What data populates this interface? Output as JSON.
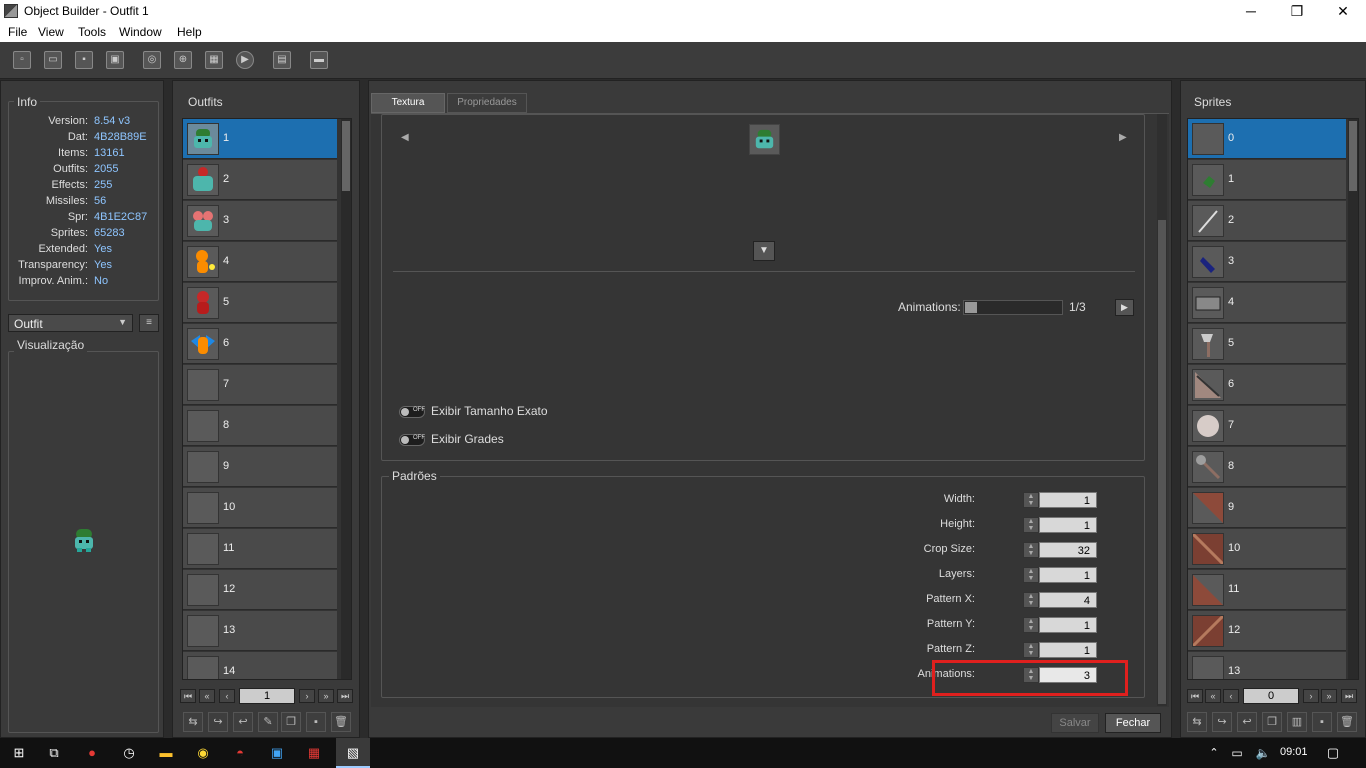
{
  "window": {
    "title": "Object Builder - Outfit 1",
    "minimize": "─",
    "maximize": "❐",
    "close": "✕"
  },
  "menu": [
    "File",
    "View",
    "Tools",
    "Window",
    "Help"
  ],
  "info": {
    "title": "Info",
    "rows": [
      {
        "k": "Version:",
        "v": "8.54 v3"
      },
      {
        "k": "Dat:",
        "v": "4B28B89E"
      },
      {
        "k": "Items:",
        "v": "13161"
      },
      {
        "k": "Outfits:",
        "v": "2055"
      },
      {
        "k": "Effects:",
        "v": "255"
      },
      {
        "k": "Missiles:",
        "v": "56"
      },
      {
        "k": "Spr:",
        "v": "4B1E2C87"
      },
      {
        "k": "Sprites:",
        "v": "65283"
      },
      {
        "k": "Extended:",
        "v": "Yes"
      },
      {
        "k": "Transparency:",
        "v": "Yes"
      },
      {
        "k": "Improv. Anim.:",
        "v": "No"
      }
    ]
  },
  "category_select": "Outfit",
  "preview_title": "Visualização",
  "outfits": {
    "title": "Outfits",
    "items": [
      "1",
      "2",
      "3",
      "4",
      "5",
      "6",
      "7",
      "8",
      "9",
      "10",
      "11",
      "12",
      "13",
      "14"
    ],
    "page": "1"
  },
  "tabs": [
    "Textura",
    "Propriedades"
  ],
  "animations_slider": {
    "label": "Animations:",
    "value": "1/3",
    "fraction": 0.0
  },
  "toggles": [
    {
      "label": "Exibir Tamanho Exato",
      "state": "OFF"
    },
    {
      "label": "Exibir Grades",
      "state": "OFF"
    }
  ],
  "padroes": {
    "title": "Padrões",
    "props": [
      {
        "k": "Width:",
        "v": "1"
      },
      {
        "k": "Height:",
        "v": "1"
      },
      {
        "k": "Crop Size:",
        "v": "32"
      },
      {
        "k": "Layers:",
        "v": "1"
      },
      {
        "k": "Pattern X:",
        "v": "4"
      },
      {
        "k": "Pattern Y:",
        "v": "1"
      },
      {
        "k": "Pattern Z:",
        "v": "1"
      },
      {
        "k": "Animations:",
        "v": "3"
      }
    ]
  },
  "buttons": {
    "save": "Salvar",
    "close": "Fechar"
  },
  "sprites": {
    "title": "Sprites",
    "items": [
      "0",
      "1",
      "2",
      "3",
      "4",
      "5",
      "6",
      "7",
      "8",
      "9",
      "10",
      "11",
      "12",
      "13"
    ],
    "page": "0"
  },
  "taskbar": {
    "time": "09:01"
  }
}
